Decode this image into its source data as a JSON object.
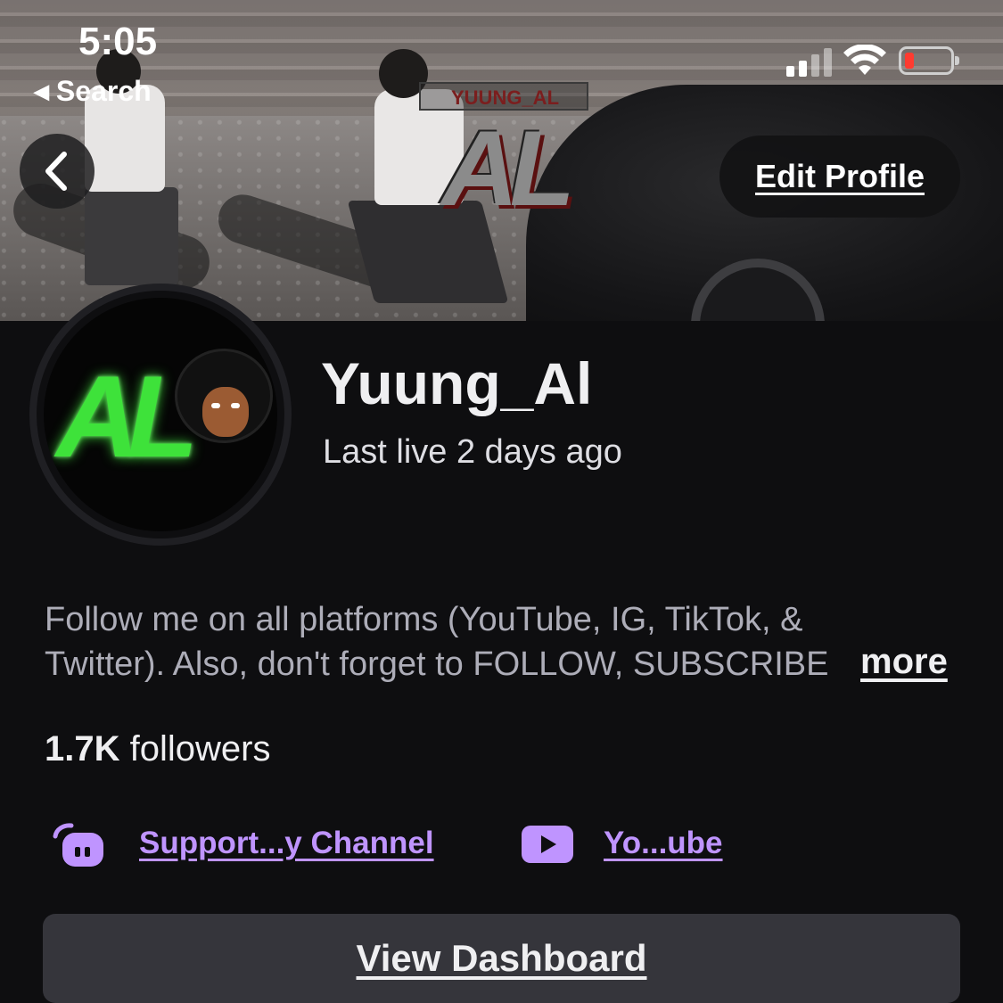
{
  "status_bar": {
    "time": "5:05",
    "back_label": "Search",
    "battery_color": "#ff3b30"
  },
  "banner": {
    "logo_tag": "YUUNG_AL",
    "logo_text": "AL"
  },
  "header": {
    "back_icon": "chevron-left-icon",
    "edit_profile_label": "Edit Profile"
  },
  "avatar": {
    "text": "AL"
  },
  "profile": {
    "username": "Yuung_Al",
    "last_live": "Last live 2 days ago",
    "bio_line1": "Follow me on all platforms (YouTube, IG, TikTok, &",
    "bio_line2": "Twitter). Also, don't forget to FOLLOW, SUBSCRIBE",
    "more_label": "more",
    "followers_count": "1.7K",
    "followers_label": " followers"
  },
  "links": [
    {
      "icon": "support-mic-icon",
      "label": "Support...y Channel"
    },
    {
      "icon": "youtube-icon",
      "label": "Yo...ube"
    }
  ],
  "actions": {
    "view_dashboard_label": "View Dashboard"
  },
  "colors": {
    "background": "#0e0e10",
    "accent": "#bf94ff",
    "button_bg": "#35353b"
  }
}
